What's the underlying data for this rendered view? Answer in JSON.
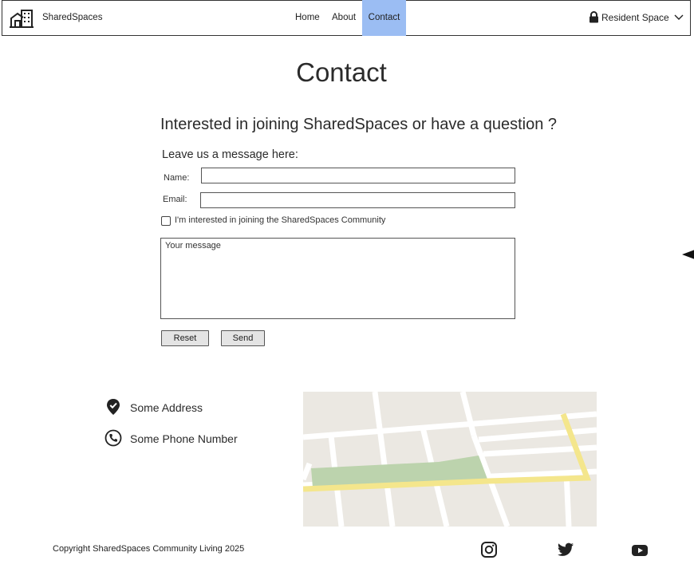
{
  "navbar": {
    "brand": "SharedSpaces",
    "links": [
      {
        "label": "Home"
      },
      {
        "label": "About"
      },
      {
        "label": "Contact",
        "active": true
      }
    ],
    "resident_label": "Resident Space",
    "active_color": "#9bbdf3"
  },
  "page": {
    "title": "Contact",
    "subtitle": "Interested in joining SharedSpaces or have a question ?",
    "lead": "Leave us a message here:"
  },
  "form": {
    "name_label": "Name:",
    "name_value": "",
    "email_label": "Email:",
    "email_value": "",
    "join_checkbox_label": "I'm interested in joining the SharedSpaces Community",
    "join_checked": false,
    "message_placeholder": "Your message",
    "reset_label": "Reset",
    "send_label": "Send"
  },
  "contact_info": {
    "address": "Some Address",
    "phone": "Some Phone Number"
  },
  "footer": {
    "copyright": "Copyright SharedSpaces Community Living 2025",
    "social": [
      "instagram-icon",
      "twitter-icon",
      "youtube-icon"
    ]
  },
  "icons": {
    "logo": "building-icon",
    "lock": "lock-icon",
    "chevron": "chevron-down-icon",
    "address": "location-check-icon",
    "phone": "phone-icon"
  }
}
